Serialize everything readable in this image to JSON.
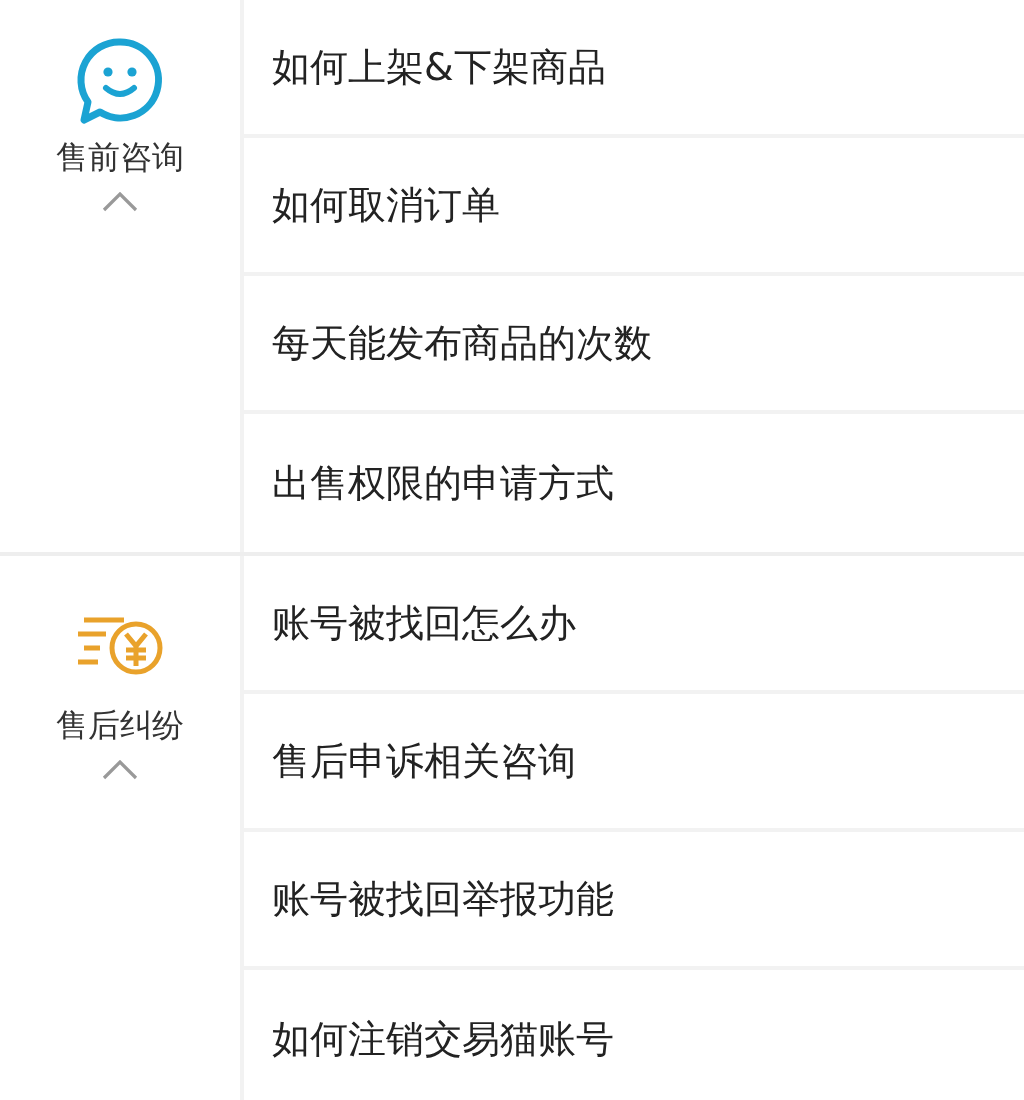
{
  "sections": [
    {
      "kind": "chat",
      "label": "售前咨询",
      "expanded": true,
      "items": [
        "如何上架&下架商品",
        "如何取消订单",
        "每天能发布商品的次数",
        "出售权限的申请方式"
      ]
    },
    {
      "kind": "coin",
      "label": "售后纠纷",
      "expanded": true,
      "items": [
        "账号被找回怎么办",
        "售后申诉相关咨询",
        "账号被找回举报功能",
        "如何注销交易猫账号"
      ]
    }
  ]
}
